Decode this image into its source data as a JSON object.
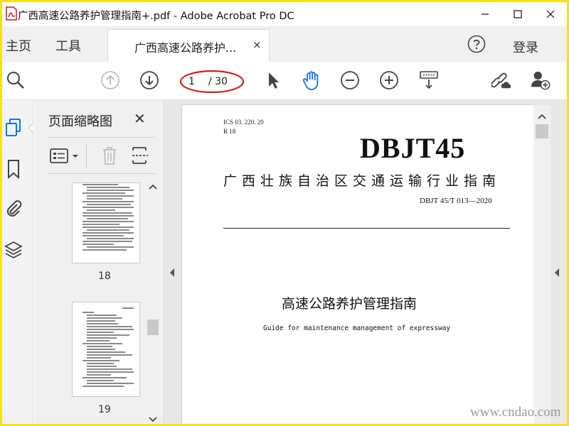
{
  "window": {
    "title": "广西高速公路养护管理指南+.pdf - Adobe Acrobat Pro DC",
    "minimize_icon": "minimize-icon",
    "maximize_icon": "maximize-icon",
    "close_icon": "close-icon"
  },
  "tabs": {
    "home": "主页",
    "tools": "工具",
    "document": "广西高速公路养护...",
    "close_glyph": "×",
    "login": "登录"
  },
  "toolbar": {
    "current_page": "1",
    "total_pages": "/ 30"
  },
  "thumbnails": {
    "title": "页面缩略图",
    "close_glyph": "✕",
    "pages": [
      {
        "number": "18"
      },
      {
        "number": "19"
      }
    ]
  },
  "document": {
    "ics": "ICS  03. 220. 20",
    "classification": "R 18",
    "code": "DBJT45",
    "agency": "广西壮族自治区交通运输行业指南",
    "standard_number": "DBJT 45/T 013—2020",
    "title": "高速公路养护管理指南",
    "subtitle": "Guide for maintenance management of expressway"
  },
  "watermark": "www.cndao.com",
  "colors": {
    "frame": "#f7e21a",
    "accent_blue": "#1473e6",
    "ellipse_red": "#d22020"
  }
}
